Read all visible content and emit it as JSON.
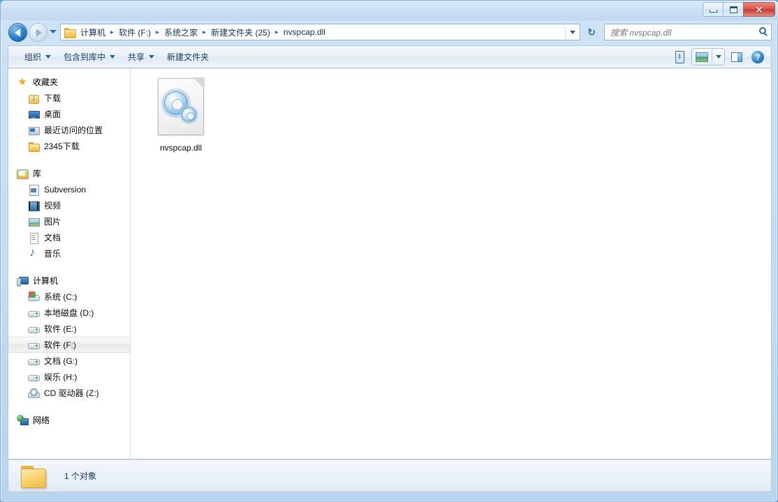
{
  "window": {
    "title": "",
    "controls": {
      "minimize": "–",
      "maximize": "□",
      "close": "✕"
    }
  },
  "address_bar": {
    "back_tooltip": "后退",
    "forward_tooltip": "前进",
    "folder_icon": "folder-icon",
    "separator": "▸",
    "breadcrumbs": [
      "计算机",
      "软件 (F:)",
      "系统之家",
      "新建文件夹 (25)",
      "nvspcap.dll"
    ],
    "dropdown_icon": "chevron-down-icon",
    "refresh_icon": "refresh-icon",
    "refresh_glyph": "↻"
  },
  "search": {
    "placeholder": "搜索 nvspcap.dll",
    "value": "",
    "icon": "search-icon"
  },
  "toolbar": {
    "items": [
      {
        "label": "组织",
        "has_caret": true
      },
      {
        "label": "包含到库中",
        "has_caret": true
      },
      {
        "label": "共享",
        "has_caret": true
      },
      {
        "label": "新建文件夹",
        "has_caret": false
      }
    ],
    "right_buttons": [
      {
        "name": "burn-button",
        "glyph": "↓"
      },
      {
        "name": "change-view-button",
        "glyph": ""
      },
      {
        "name": "preview-pane-button",
        "glyph": ""
      },
      {
        "name": "help-button",
        "glyph": "?"
      }
    ]
  },
  "sidebar": {
    "groups": [
      {
        "head": {
          "label": "收藏夹",
          "icon": "star-icon",
          "icon_class": "ico-star",
          "glyph": "★"
        },
        "items": [
          {
            "label": "下载",
            "icon": "downloads-icon",
            "icon_class": "ico-download",
            "selected": false
          },
          {
            "label": "桌面",
            "icon": "desktop-icon",
            "icon_class": "ico-desktop",
            "selected": false
          },
          {
            "label": "最近访问的位置",
            "icon": "recent-places-icon",
            "icon_class": "ico-recent",
            "selected": false
          },
          {
            "label": "2345下载",
            "icon": "folder-icon",
            "icon_class": "ico-folder",
            "selected": false
          }
        ]
      },
      {
        "head": {
          "label": "库",
          "icon": "library-icon",
          "icon_class": "ico-library",
          "glyph": ""
        },
        "items": [
          {
            "label": "Subversion",
            "icon": "subversion-icon",
            "icon_class": "ico-subversion",
            "selected": false
          },
          {
            "label": "视频",
            "icon": "videos-icon",
            "icon_class": "ico-video",
            "selected": false
          },
          {
            "label": "图片",
            "icon": "pictures-icon",
            "icon_class": "ico-picture",
            "selected": false
          },
          {
            "label": "文档",
            "icon": "documents-icon",
            "icon_class": "ico-doc",
            "selected": false
          },
          {
            "label": "音乐",
            "icon": "music-icon",
            "icon_class": "ico-music",
            "selected": false
          }
        ]
      },
      {
        "head": {
          "label": "计算机",
          "icon": "computer-icon",
          "icon_class": "ico-computer",
          "glyph": ""
        },
        "items": [
          {
            "label": "系统 (C:)",
            "icon": "system-drive-icon",
            "icon_class": "ico-drive-sys",
            "selected": false
          },
          {
            "label": "本地磁盘 (D:)",
            "icon": "drive-icon",
            "icon_class": "ico-drive",
            "selected": false
          },
          {
            "label": "软件 (E:)",
            "icon": "drive-icon",
            "icon_class": "ico-drive",
            "selected": false
          },
          {
            "label": "软件 (F:)",
            "icon": "drive-icon",
            "icon_class": "ico-drive",
            "selected": true
          },
          {
            "label": "文档 (G:)",
            "icon": "drive-icon",
            "icon_class": "ico-drive",
            "selected": false
          },
          {
            "label": "娱乐 (H:)",
            "icon": "drive-icon",
            "icon_class": "ico-drive",
            "selected": false
          },
          {
            "label": "CD 驱动器 (Z:)",
            "icon": "cd-drive-icon",
            "icon_class": "ico-cd",
            "selected": false
          }
        ]
      },
      {
        "head": {
          "label": "网络",
          "icon": "network-icon",
          "icon_class": "ico-network",
          "glyph": ""
        },
        "items": []
      }
    ]
  },
  "content": {
    "files": [
      {
        "name": "nvspcap.dll",
        "icon": "dll-file-icon",
        "selected": false
      }
    ]
  },
  "statusbar": {
    "icon": "folder-icon",
    "text": "1 个对象"
  },
  "colors": {
    "accent": "#2a7fc8",
    "titlebar": "#cbe0f6",
    "selection": "#f0f0f0",
    "folder_yellow": "#f8d577"
  }
}
